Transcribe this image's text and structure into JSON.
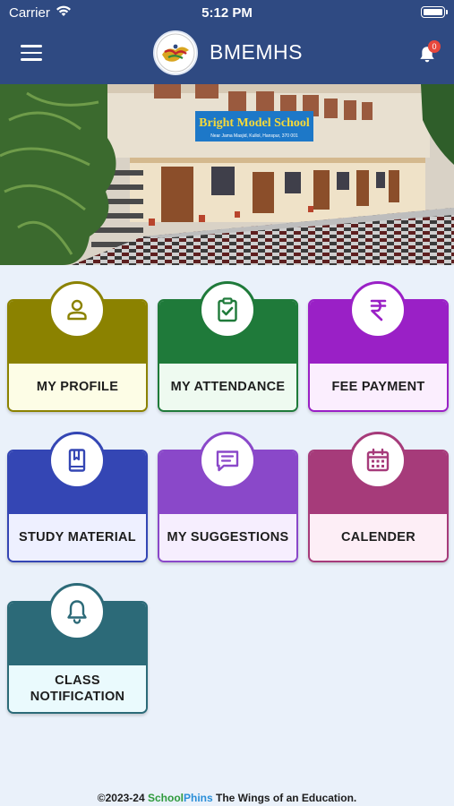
{
  "status_bar": {
    "carrier": "Carrier",
    "time": "5:12 PM"
  },
  "header": {
    "title": "BMEMHS",
    "notification_count": "0",
    "menu_icon": "hamburger-menu-icon",
    "bell_icon": "bell-icon"
  },
  "banner": {
    "sign_title": "Bright Model School",
    "sign_address": "Near Jama Masjid, Kullol, Hanspur, 370 001"
  },
  "tiles": [
    {
      "label": "MY PROFILE",
      "icon": "person-icon",
      "top_color": "#8b8200",
      "bottom_color": "#fdfde6",
      "border_color": "#8b8200"
    },
    {
      "label": "MY ATTENDANCE",
      "icon": "clipboard-check-icon",
      "top_color": "#1f7a3a",
      "bottom_color": "#eefaf0",
      "border_color": "#1f7a3a"
    },
    {
      "label": "FEE PAYMENT",
      "icon": "rupee-icon",
      "top_color": "#9a20c6",
      "bottom_color": "#fbeefe",
      "border_color": "#9a20c6"
    },
    {
      "label": "STUDY MATERIAL",
      "icon": "book-icon",
      "top_color": "#3446b4",
      "bottom_color": "#eef0ff",
      "border_color": "#3446b4"
    },
    {
      "label": "MY SUGGESTIONS",
      "icon": "chat-icon",
      "top_color": "#8a48c9",
      "bottom_color": "#f6eefe",
      "border_color": "#8a48c9"
    },
    {
      "label": "CALENDER",
      "icon": "calendar-icon",
      "top_color": "#a63b7a",
      "bottom_color": "#fdeef6",
      "border_color": "#a63b7a"
    },
    {
      "label": "CLASS NOTIFICATION",
      "icon": "bell-outline-icon",
      "top_color": "#2c6a78",
      "bottom_color": "#eafafd",
      "border_color": "#2c6a78"
    }
  ],
  "footer": {
    "prefix": "©2023-24",
    "brand_a": "School",
    "brand_b": "Phins",
    "suffix": "The Wings of an Education."
  }
}
